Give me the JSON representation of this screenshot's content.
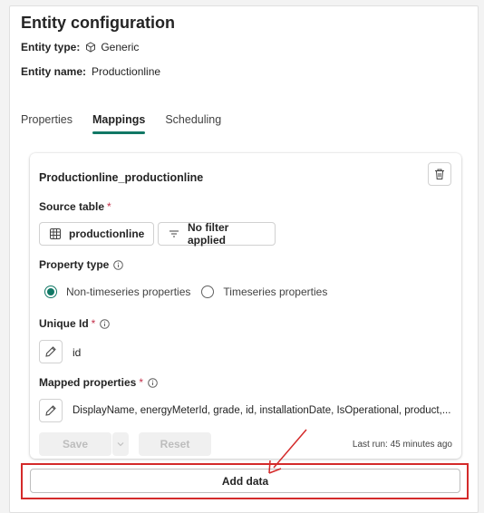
{
  "header": {
    "title": "Entity configuration",
    "entity_type_label": "Entity type:",
    "entity_type_value": "Generic",
    "entity_name_label": "Entity name:",
    "entity_name_value": "Productionline"
  },
  "tabs": [
    {
      "label": "Properties",
      "active": false
    },
    {
      "label": "Mappings",
      "active": true
    },
    {
      "label": "Scheduling",
      "active": false
    }
  ],
  "mapping_card": {
    "title": "Productionline_productionline",
    "source_table_label": "Source table",
    "required_mark": "*",
    "source_table_value": "productionline",
    "filter_label": "No filter applied",
    "property_type_label": "Property type",
    "property_type_options": [
      {
        "label": "Non-timeseries properties",
        "selected": true
      },
      {
        "label": "Timeseries properties",
        "selected": false
      }
    ],
    "unique_id_label": "Unique Id",
    "unique_id_value": "id",
    "mapped_properties_label": "Mapped properties",
    "mapped_properties_value": "DisplayName, energyMeterId, grade, id, installationDate, IsOperational, product,...",
    "save_label": "Save",
    "reset_label": "Reset",
    "last_run": "Last run: 45 minutes ago"
  },
  "add_data_label": "Add data",
  "colors": {
    "accent": "#117865",
    "highlight": "#d42a2a",
    "required": "#c4314b"
  },
  "icons": [
    "cube-icon",
    "delete-icon",
    "table-icon",
    "filter-icon",
    "info-icon",
    "edit-icon",
    "chevron-down-icon"
  ]
}
